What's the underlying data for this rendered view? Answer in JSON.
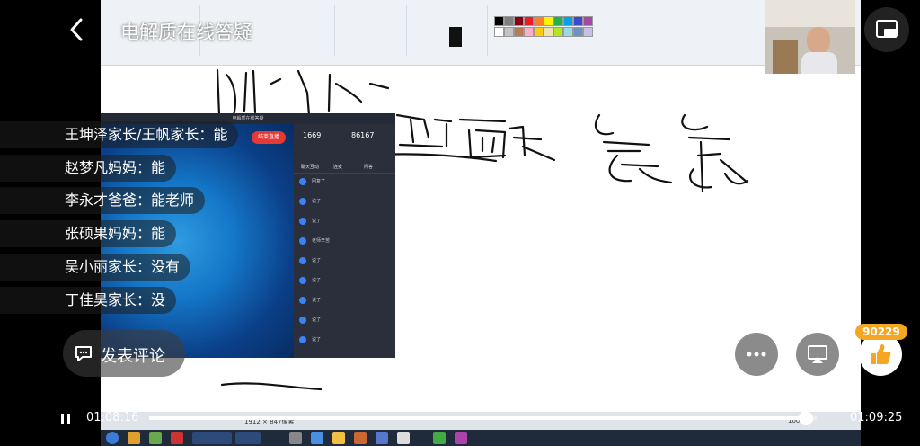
{
  "header": {
    "title": "电解质在线答疑"
  },
  "popup": {
    "title": "电解质在线答疑",
    "end_button": "结束直播",
    "stats": [
      {
        "value": "1669"
      },
      {
        "value": "86167"
      }
    ],
    "tabs": [
      "聊天互动",
      "连麦",
      "问答"
    ],
    "messages": [
      "回复了",
      "说了",
      "说了",
      "老师辛苦",
      "说了",
      "说了",
      "说了",
      "说了",
      "说了"
    ]
  },
  "chat": [
    {
      "name": "王坤泽家长/王帆家长",
      "text": "能"
    },
    {
      "name": "赵梦凡妈妈",
      "text": "能"
    },
    {
      "name": "李永才爸爸",
      "text": "能老师"
    },
    {
      "name": "张硕果妈妈",
      "text": "能"
    },
    {
      "name": "吴小丽家长",
      "text": "没有"
    },
    {
      "name": "丁佳昊家长",
      "text": "没"
    }
  ],
  "comment": {
    "label": "发表评论"
  },
  "likes": {
    "count": "90229"
  },
  "player": {
    "current_time": "01:08:16",
    "total_time": "01:09:25",
    "progress": 0.9834
  },
  "status": {
    "size": "1912 × 847像素",
    "zoom": "100%"
  }
}
